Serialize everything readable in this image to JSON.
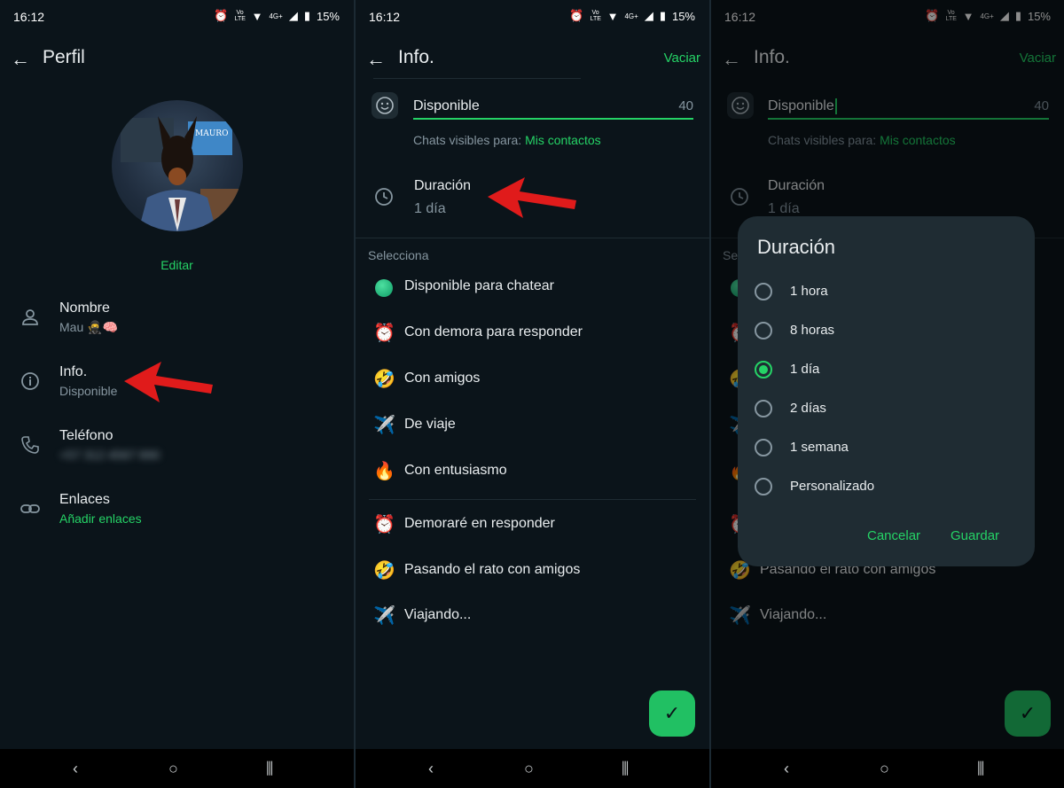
{
  "status": {
    "time": "16:12",
    "net": "Vo LTE",
    "net2": "4G+",
    "battery": "15%"
  },
  "panel1": {
    "title": "Perfil",
    "avatar_text": "MAURO",
    "edit": "Editar",
    "name_label": "Nombre",
    "name_value": "Mau 🥷🧠",
    "info_label": "Info.",
    "info_value": "Disponible",
    "phone_label": "Teléfono",
    "phone_value": "+57 312 4567 890",
    "links_label": "Enlaces",
    "links_value": "Añadir enlaces"
  },
  "panel2": {
    "title": "Info.",
    "clear": "Vaciar",
    "status_text": "Disponible",
    "char_count": "40",
    "visible_prefix": "Chats visibles para: ",
    "visible_value": "Mis contactos",
    "duration_label": "Duración",
    "duration_value": "1 día",
    "section_label": "Selecciona",
    "options": [
      {
        "emoji": "🟢",
        "text": "Disponible para chatear"
      },
      {
        "emoji": "⏰",
        "text": "Con demora para responder"
      },
      {
        "emoji": "🤣",
        "text": "Con amigos"
      },
      {
        "emoji": "✈️",
        "text": "De viaje"
      },
      {
        "emoji": "🔥",
        "text": "Con entusiasmo"
      },
      {
        "emoji": "⏰",
        "text": "Demoraré en responder"
      },
      {
        "emoji": "🤣",
        "text": "Pasando el rato con amigos"
      },
      {
        "emoji": "✈️",
        "text": "Viajando..."
      }
    ]
  },
  "panel3": {
    "section_partial": "Se",
    "dialog": {
      "title": "Duración",
      "options": [
        "1 hora",
        "8 horas",
        "1 día",
        "2 días",
        "1 semana",
        "Personalizado"
      ],
      "selected": "1 día",
      "cancel": "Cancelar",
      "save": "Guardar"
    }
  },
  "colors": {
    "accent": "#25d366",
    "background": "#0b141a",
    "dialog": "#1f2c33",
    "arrow": "#e01b1b"
  }
}
